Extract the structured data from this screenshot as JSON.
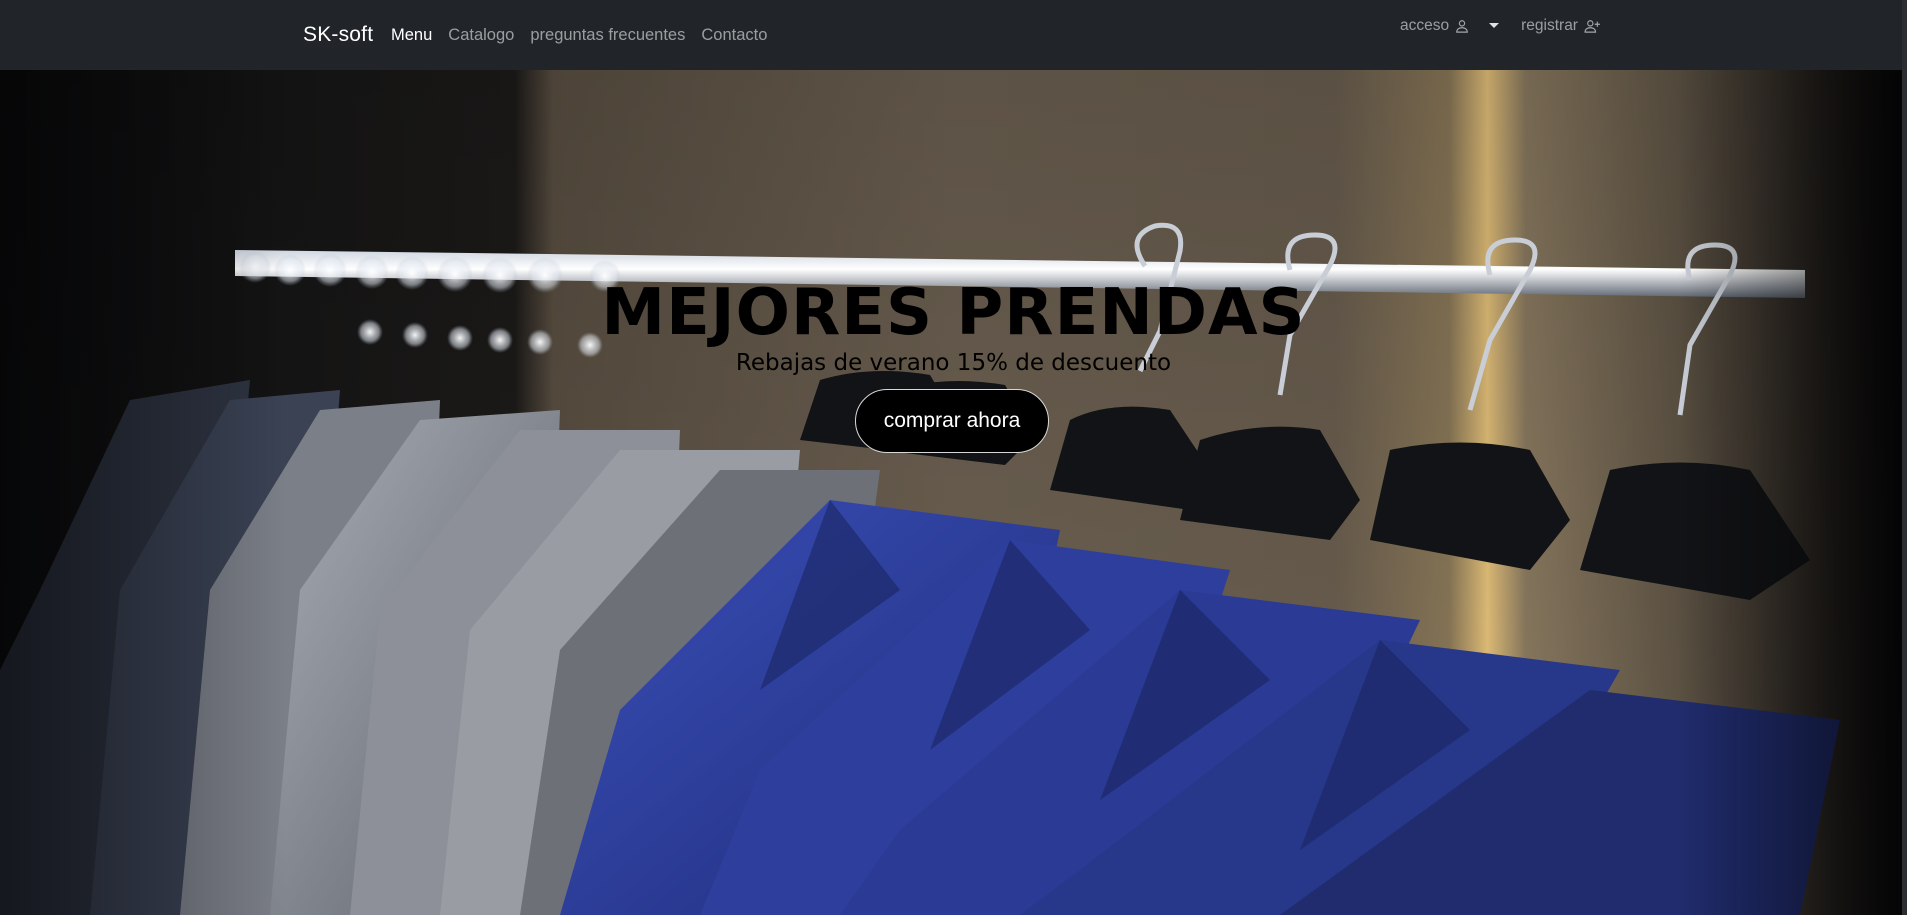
{
  "navbar": {
    "brand": "SK-soft",
    "links": [
      {
        "label": "Menu",
        "active": true
      },
      {
        "label": "Catalogo",
        "active": false
      },
      {
        "label": "preguntas frecuentes",
        "active": false
      },
      {
        "label": "Contacto",
        "active": false
      }
    ],
    "login_label": "acceso",
    "login_icon": "user-icon",
    "register_label": "registrar",
    "register_icon": "user-plus-icon",
    "dropdown_icon": "caret-down-icon"
  },
  "hero": {
    "title": "MEJORES PRENDAS",
    "subtitle": "Rebajas de verano 15% de descuento",
    "cta_label": "comprar ahora",
    "background_description_icon": "clothes-rack-image"
  },
  "colors": {
    "navbar_bg": "#212529",
    "nav_text_muted": "rgba(255,255,255,0.55)",
    "nav_text_active": "#ffffff",
    "hero_text": "#000000",
    "cta_bg": "#000000",
    "jacket_blue": "#2b3e9a"
  }
}
